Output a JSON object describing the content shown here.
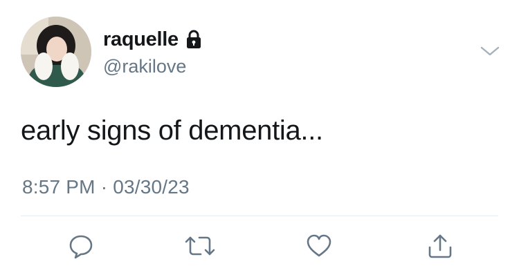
{
  "tweet": {
    "display_name": "raquelle",
    "handle": "@rakilove",
    "protected_icon": "lock-icon",
    "text": "early signs of dementia...",
    "time": "8:57 PM",
    "separator": "·",
    "date": "03/30/23"
  },
  "menu_icon": "chevron-down-icon",
  "actions": [
    {
      "name": "reply",
      "icon": "speech-bubble-icon"
    },
    {
      "name": "retweet",
      "icon": "retweet-icon"
    },
    {
      "name": "like",
      "icon": "heart-icon"
    },
    {
      "name": "share",
      "icon": "share-icon"
    }
  ],
  "colors": {
    "text_primary": "#14171a",
    "text_secondary": "#657786",
    "icon": "#657786",
    "divider": "#e6ecf0"
  }
}
